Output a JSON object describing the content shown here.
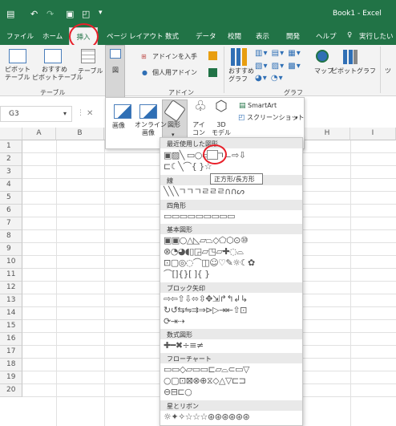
{
  "titlebar": {
    "book_title": "Book1 - Excel",
    "qat": [
      "save-icon",
      "undo-icon",
      "redo-icon",
      "open-icon",
      "print-preview-icon",
      "customize-icon"
    ]
  },
  "tabs": [
    {
      "label": "ファイル"
    },
    {
      "label": "ホーム"
    },
    {
      "label": "挿入"
    },
    {
      "label": "ページ レイアウト"
    },
    {
      "label": "数式"
    },
    {
      "label": "データ"
    },
    {
      "label": "校閲"
    },
    {
      "label": "表示"
    },
    {
      "label": "開発"
    },
    {
      "label": "ヘルプ"
    },
    {
      "label": "実行したい"
    }
  ],
  "ribbon": {
    "pivot": "ピボット\nテーブル",
    "pivot_l1": "ピボット",
    "pivot_l2": "テーブル",
    "recommend_l1": "おすすめ",
    "recommend_l2": "ピボットテーブル",
    "table": "テーブル",
    "group_table": "テーブル",
    "figure": "図",
    "addin_get": "アドインを入手",
    "my_addin": "個人用アドイン",
    "group_addin": "アドイン",
    "rec_chart_l1": "おすすめ",
    "rec_chart_l2": "グラフ",
    "group_chart": "グラフ",
    "map": "マップ",
    "pivot_chart": "ピボットグラフ",
    "tour": "ツ"
  },
  "namebox": {
    "value": "G3"
  },
  "columns": [
    "A",
    "B",
    "H",
    "I"
  ],
  "rows": [
    "1",
    "2",
    "3",
    "4",
    "5",
    "6",
    "7",
    "8",
    "9",
    "10",
    "11",
    "12",
    "13",
    "14",
    "15",
    "16",
    "17",
    "18",
    "19",
    "20"
  ],
  "illus_panel": {
    "image": "画像",
    "online_l1": "オンライン",
    "online_l2": "画像",
    "shape": "図形",
    "icon_l1": "アイ",
    "icon_l2": "コン",
    "model_l1": "3D",
    "model_l2": "モデル",
    "smartart": "SmartArt",
    "screenshot": "スクリーンショット"
  },
  "shapes_panel": {
    "sections": [
      {
        "title": "最近使用した図形",
        "rows": [
          "▣▨╲ ▭○▭△ㄱㄴ⇨⇩",
          "⊏☾╲⌒{ }☆"
        ]
      },
      {
        "title": "線",
        "rows": [
          "╲╲╲ㄱㄱㄱㄹㄹㄹ∩∩ᔕ"
        ]
      },
      {
        "title": "四角形",
        "rows": [
          "▭▭▭▭▭▭▭▭▭"
        ]
      },
      {
        "title": "基本図形",
        "rows": [
          "▣▣○△◺▱⏢◇⬠⬡⊙⑩",
          "⊗◔◕◖▯◲▱◳▱✚◌⌓",
          "⊡▢◎◌⌒◫☺♡✎☼☾✿",
          "⌒[]{}[ ]{ }"
        ]
      },
      {
        "title": "ブロック矢印",
        "rows": [
          "⇨⇦⇧⇩⬄⇳✥⇲↱↰↲↳",
          "↻↺⇆⇋⇉⇒⊳▷⇥⇤⇧⊡",
          "⟳⇥⇢"
        ]
      },
      {
        "title": "数式図形",
        "rows": [
          "✚━✖÷≡≠"
        ]
      },
      {
        "title": "フローチャート",
        "rows": [
          "▭▭◇▱▭▭⊏▱⌓⊂▭▽",
          "○▢⊡⊠⊗⊕⧖◇△▽⊏⊐",
          "⊖⊟⊏○"
        ]
      },
      {
        "title": "星とリボン",
        "rows": [
          "☼✦✧☆☆☆⊛⊛⊛⊛⊛⊛"
        ]
      }
    ],
    "tooltip": "正方形/長方形"
  },
  "colors": {
    "excel_green": "#217346",
    "highlight_red": "#e8202a"
  }
}
